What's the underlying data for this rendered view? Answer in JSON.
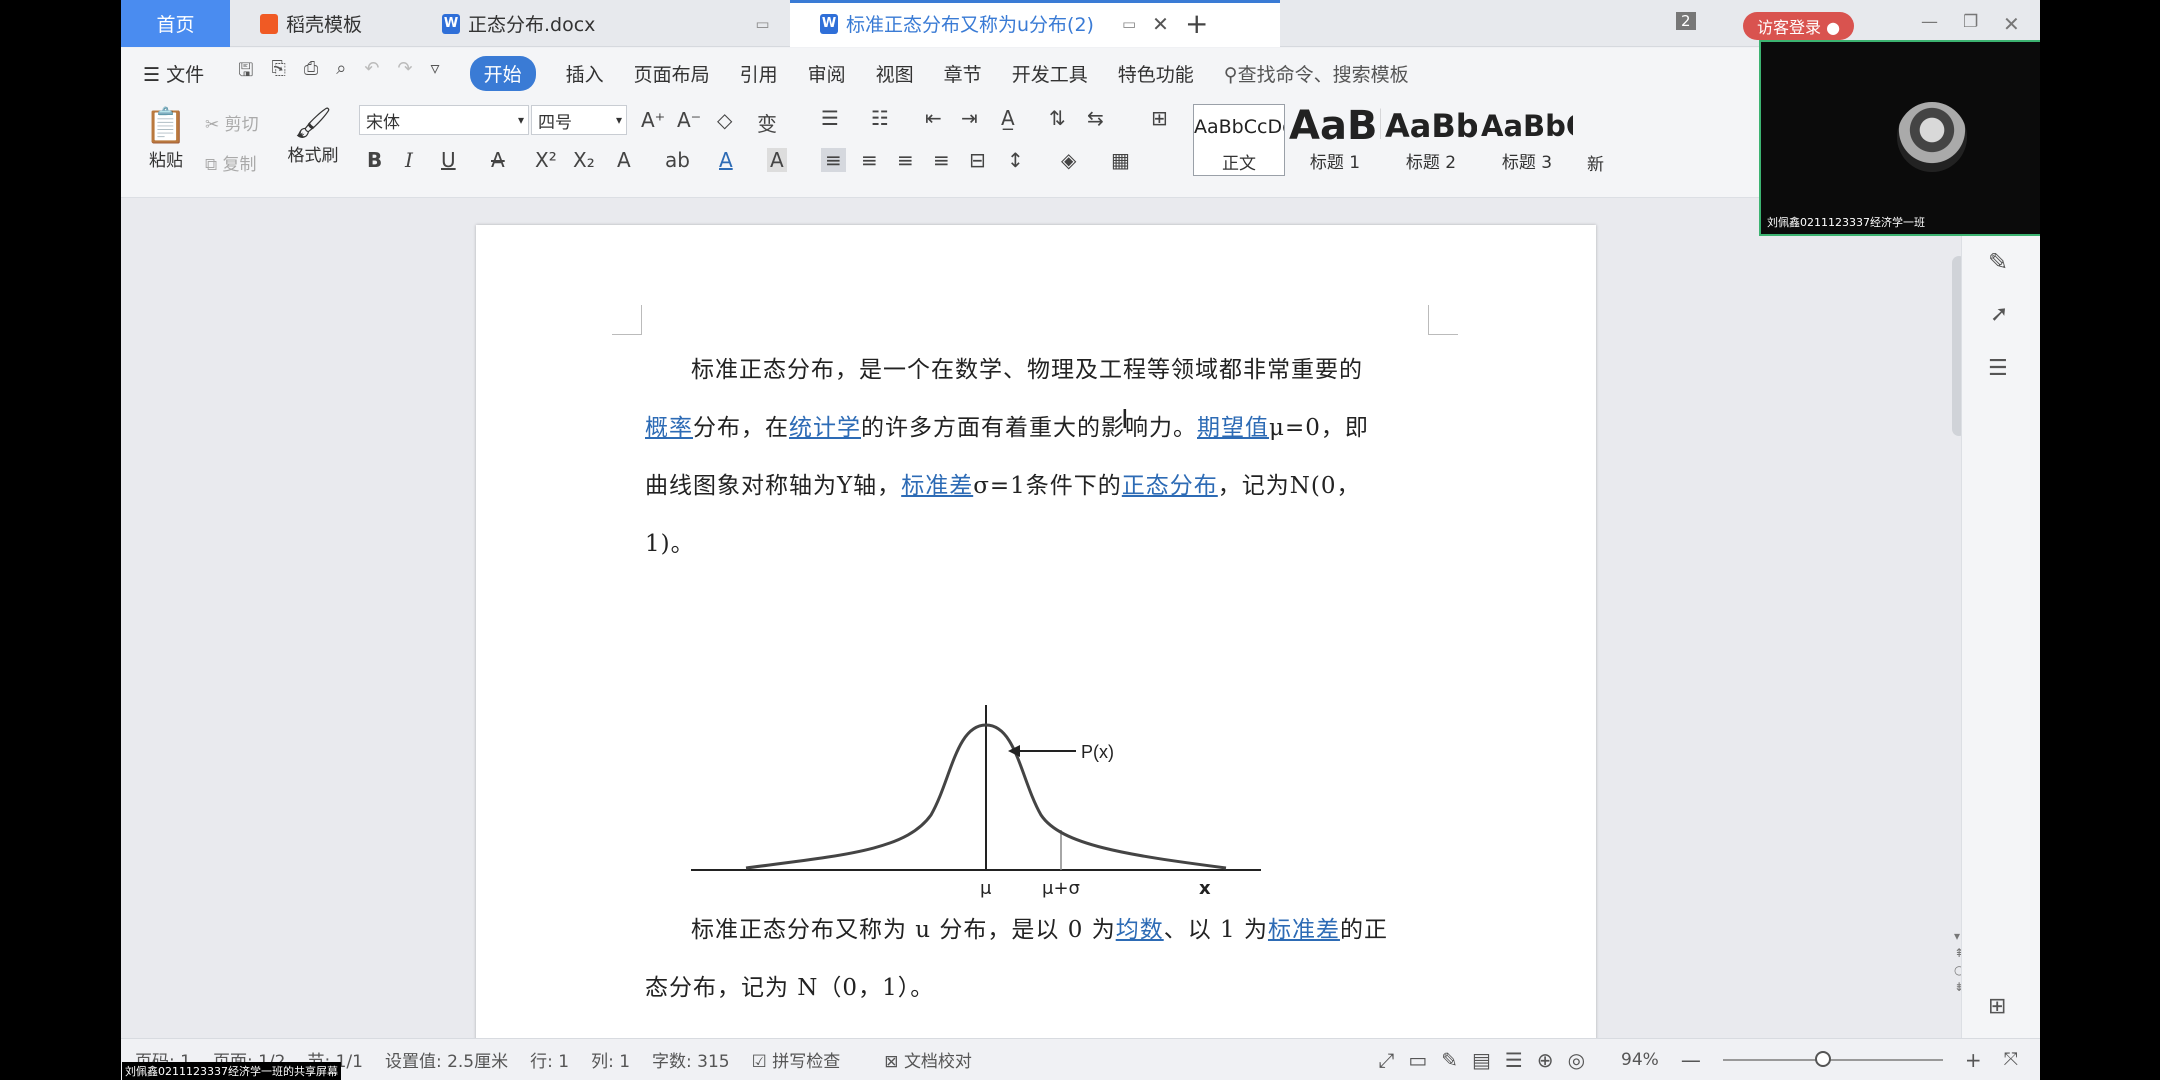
{
  "tabs": {
    "home": "首页",
    "daoke": "稻壳模板",
    "doc1": "正态分布.docx",
    "doc2": "标准正态分布又称为u分布(2)",
    "new_tab": "+",
    "count_badge": "2",
    "login": "访客登录"
  },
  "menu": {
    "file": "文件",
    "items": [
      "开始",
      "插入",
      "页面布局",
      "引用",
      "审阅",
      "视图",
      "章节",
      "开发工具",
      "特色功能"
    ],
    "search": "查找命令、搜索模板"
  },
  "ribbon": {
    "paste": "粘贴",
    "cut": "剪切",
    "copy": "复制",
    "format_painter": "格式刷",
    "font_name": "宋体",
    "font_size": "四号",
    "styles": [
      {
        "preview": "AaBbCcDd",
        "label": "正文"
      },
      {
        "preview": "AaBl",
        "label": "标题 1"
      },
      {
        "preview": "AaBb(",
        "label": "标题 2"
      },
      {
        "preview": "AaBbC",
        "label": "标题 3"
      }
    ],
    "new_style": "新"
  },
  "document": {
    "p1": {
      "t1": "标准正态分布，是一个在数学、物理及工程等领域都非常重要的",
      "l1": "概率",
      "t2": "分布，在",
      "l2": "统计学",
      "t3": "的许多方面有着重大的影响力。",
      "l3": "期望值",
      "t4": "μ=0，即",
      "t5": "曲线图象对称轴为Y轴，",
      "l4": "标准差",
      "t6": "σ=1条件下的",
      "l5": "正态分布",
      "t7": "，记为N(0，",
      "t8": "1)。"
    },
    "p2": {
      "t1": "标准正态分布又称为 u 分布，是以 0 为",
      "l1": "均数",
      "t2": "、以 1 为",
      "l2": "标准差",
      "t3": "的正",
      "t4": "态分布，记为 N（0，1）。"
    },
    "figure": {
      "px_label": "P(x)",
      "mu_label": "μ",
      "mu_sigma_label": "μ+σ",
      "x_label": "x"
    }
  },
  "status": {
    "page_no": "页码: 1",
    "page_of": "页面: 1/2",
    "section": "节: 1/1",
    "setting": "设置值: 2.5厘米",
    "row": "行: 1",
    "col": "列: 1",
    "words": "字数: 315",
    "spell": "拼写检查",
    "proof": "文档校对",
    "zoom": "94%"
  },
  "video": {
    "name": "刘佩鑫0211123337经济学一班"
  },
  "share_label": "刘佩鑫0211123337经济学一班的共享屏幕"
}
